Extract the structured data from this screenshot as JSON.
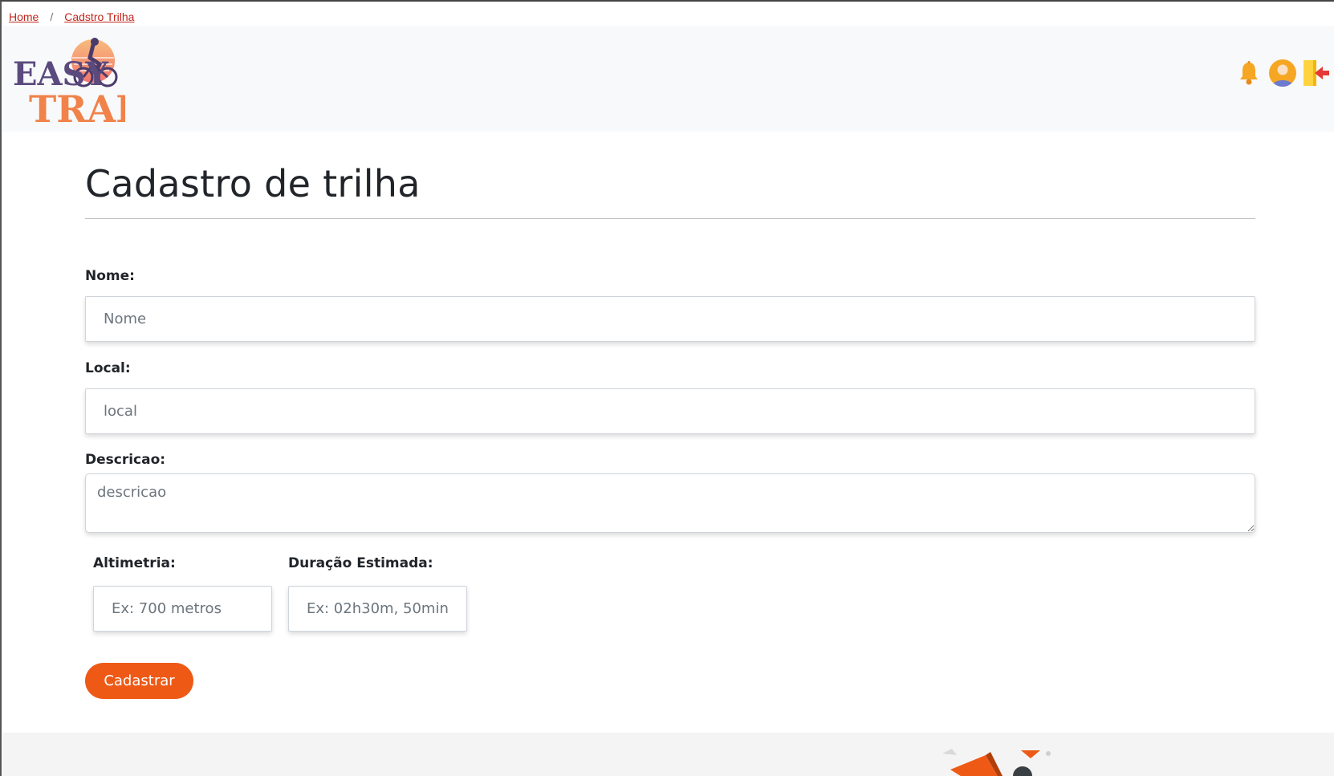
{
  "breadcrumb": {
    "items": [
      "Home",
      "Cadstro Trilha"
    ],
    "separator": "/"
  },
  "header": {
    "logo_text_top": "EASY",
    "logo_text_bottom": "TRAIL",
    "icons": [
      "bell-icon",
      "user-avatar-icon",
      "logout-icon"
    ]
  },
  "page": {
    "title": "Cadastro de trilha"
  },
  "form": {
    "nome": {
      "label": "Nome:",
      "placeholder": "Nome",
      "value": ""
    },
    "local": {
      "label": "Local:",
      "placeholder": "local",
      "value": ""
    },
    "descricao": {
      "label": "Descricao:",
      "placeholder": "descricao",
      "value": ""
    },
    "altimetria": {
      "label": "Altimetria:",
      "placeholder": "Ex: 700 metros",
      "value": ""
    },
    "duracao": {
      "label": "Duração Estimada:",
      "placeholder": "Ex: 02h30m, 50min",
      "value": ""
    },
    "submit_label": "Cadastrar"
  },
  "colors": {
    "accent": "#ee5a16",
    "link": "#c0271e",
    "logo_purple": "#5b4a7e",
    "logo_orange": "#f0824a"
  }
}
